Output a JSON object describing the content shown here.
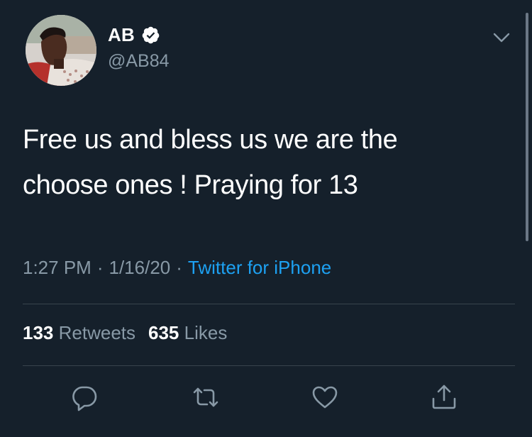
{
  "tweet": {
    "author": {
      "display_name": "AB",
      "handle": "@AB84",
      "verified_icon": "verified-badge-icon"
    },
    "text_line1": "Free us and bless us we are the",
    "text_line2": "choose ones ! Praying for 13",
    "time": "1:27 PM",
    "date": "1/16/20",
    "separator": "·",
    "source": "Twitter for iPhone",
    "stats": {
      "retweets_count": "133",
      "retweets_label": "Retweets",
      "likes_count": "635",
      "likes_label": "Likes"
    },
    "actions": [
      {
        "name": "reply",
        "icon": "reply-icon"
      },
      {
        "name": "retweet",
        "icon": "retweet-icon"
      },
      {
        "name": "like",
        "icon": "heart-icon"
      },
      {
        "name": "share",
        "icon": "share-icon"
      }
    ]
  },
  "colors": {
    "background": "#15202b",
    "primary_text": "#ffffff",
    "secondary_text": "#8899a6",
    "accent": "#1da1f2",
    "divider": "#38444d"
  }
}
